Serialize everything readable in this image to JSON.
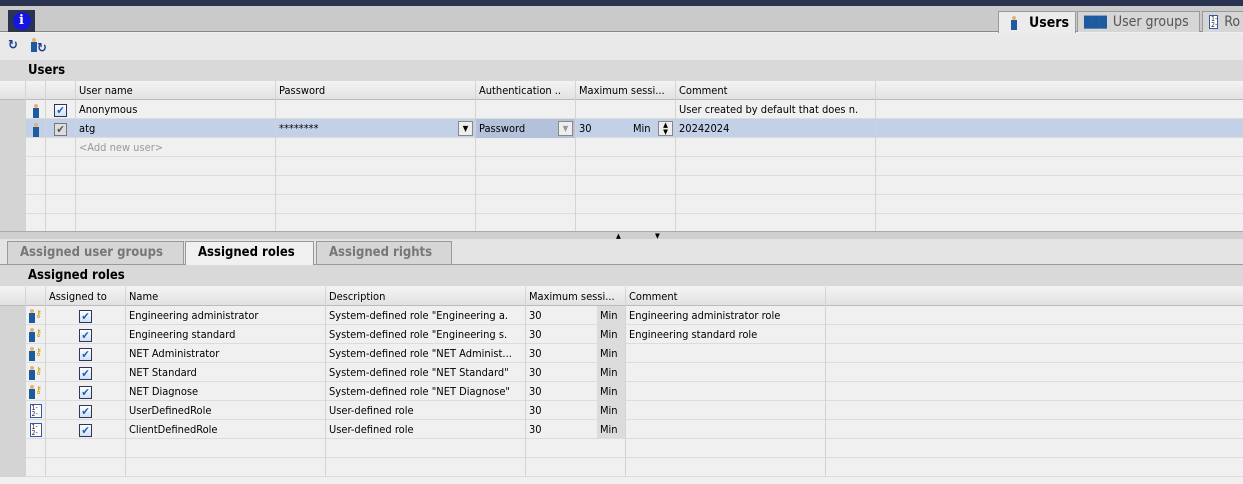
{
  "header": {
    "info_icon": "info-icon",
    "tabs": [
      {
        "label": "Users",
        "active": true
      },
      {
        "label": "User groups",
        "active": false
      },
      {
        "label": "Ro",
        "active": false
      }
    ]
  },
  "toolbar": {
    "icons": [
      "synchronize-icon",
      "user-update-icon"
    ]
  },
  "users": {
    "title": "Users",
    "columns": [
      "User name",
      "Password",
      "Authentication ..",
      "Maximum sessi...",
      "Comment"
    ],
    "rows": [
      {
        "name": "Anonymous",
        "password": "",
        "auth": "",
        "session": "",
        "unit": "",
        "comment": "User created by default that does n.",
        "checked": true
      },
      {
        "name": "atg",
        "password": "********",
        "auth": "Password",
        "session": "30",
        "unit": "Min",
        "comment": "20242024",
        "checked": true,
        "selected": true
      }
    ],
    "add_placeholder": "<Add new user>"
  },
  "bottom_tabs": [
    {
      "label": "Assigned user groups",
      "active": false
    },
    {
      "label": "Assigned roles",
      "active": true
    },
    {
      "label": "Assigned rights",
      "active": false
    }
  ],
  "roles": {
    "title": "Assigned roles",
    "columns": [
      "Assigned to",
      "Name",
      "Description",
      "Maximum sessi...",
      "Comment"
    ],
    "rows": [
      {
        "type": "system",
        "name": "Engineering administrator",
        "description": "System-defined role \"Engineering a.",
        "session": "30",
        "unit": "Min",
        "comment": "Engineering administrator role"
      },
      {
        "type": "system",
        "name": "Engineering standard",
        "description": "System-defined role \"Engineering s.",
        "session": "30",
        "unit": "Min",
        "comment": "Engineering standard role"
      },
      {
        "type": "system",
        "name": "NET Administrator",
        "description": "System-defined role \"NET Administ...",
        "session": "30",
        "unit": "Min",
        "comment": ""
      },
      {
        "type": "system",
        "name": "NET Standard",
        "description": "System-defined role \"NET Standard\"",
        "session": "30",
        "unit": "Min",
        "comment": ""
      },
      {
        "type": "system",
        "name": "NET Diagnose",
        "description": "System-defined role \"NET Diagnose\"",
        "session": "30",
        "unit": "Min",
        "comment": ""
      },
      {
        "type": "user",
        "name": "UserDefinedRole",
        "description": "User-defined role",
        "session": "30",
        "unit": "Min",
        "comment": ""
      },
      {
        "type": "user",
        "name": "ClientDefinedRole",
        "description": "User-defined role",
        "session": "30",
        "unit": "Min",
        "comment": ""
      }
    ]
  }
}
